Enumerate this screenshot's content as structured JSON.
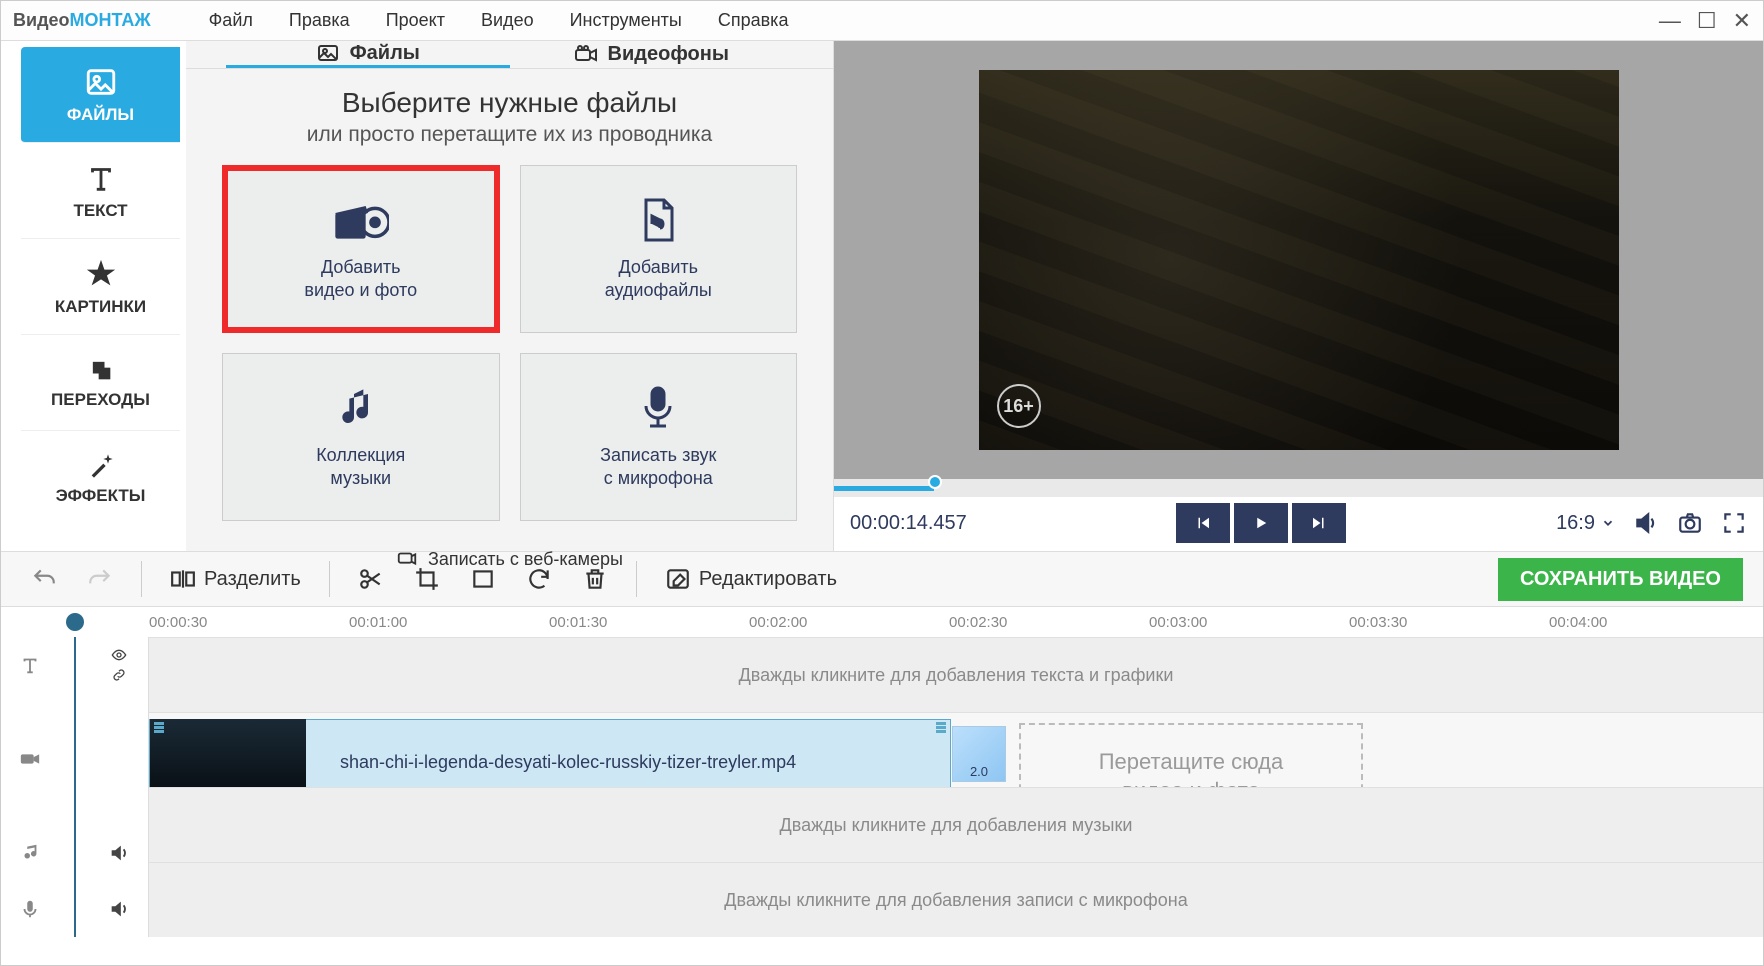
{
  "app": {
    "logo1": "Видео",
    "logo2": "МОНТАЖ"
  },
  "menu": {
    "m0": "Файл",
    "m1": "Правка",
    "m2": "Проект",
    "m3": "Видео",
    "m4": "Инструменты",
    "m5": "Справка"
  },
  "sidebar": {
    "t0": "ФАЙЛЫ",
    "t1": "ТЕКСТ",
    "t2": "КАРТИНКИ",
    "t3": "ПЕРЕХОДЫ",
    "t4": "ЭФФЕКТЫ"
  },
  "panel": {
    "tab0": "Файлы",
    "tab1": "Видеофоны",
    "big": "Выберите нужные файлы",
    "sub": "или просто перетащите их из проводника",
    "c0a": "Добавить",
    "c0b": "видео и фото",
    "c1a": "Добавить",
    "c1b": "аудиофайлы",
    "c2a": "Коллекция",
    "c2b": "музыки",
    "c3a": "Записать звук",
    "c3b": "с микрофона",
    "c4": "Записать с веб-камеры"
  },
  "preview": {
    "rating": "16+",
    "time": "00:00:14.457",
    "aspect": "16:9"
  },
  "toolbar": {
    "split": "Разделить",
    "edit": "Редактировать",
    "save": "СОХРАНИТЬ ВИДЕО"
  },
  "ruler": {
    "t0": "00:00:30",
    "t1": "00:01:00",
    "t2": "00:01:30",
    "t3": "00:02:00",
    "t4": "00:02:30",
    "t5": "00:03:00",
    "t6": "00:03:30",
    "t7": "00:04:00"
  },
  "track": {
    "textHint": "Дважды кликните для добавления текста и графики",
    "clipName": "shan-chi-i-legenda-desyati-kolec-russkiy-tizer-treyler.mp4",
    "trBadge": "2.0",
    "dropHint": "Перетащите сюда\nвидео и фото",
    "musicHint": "Дважды кликните для добавления музыки",
    "micHint": "Дважды кликните для добавления записи с микрофона"
  }
}
